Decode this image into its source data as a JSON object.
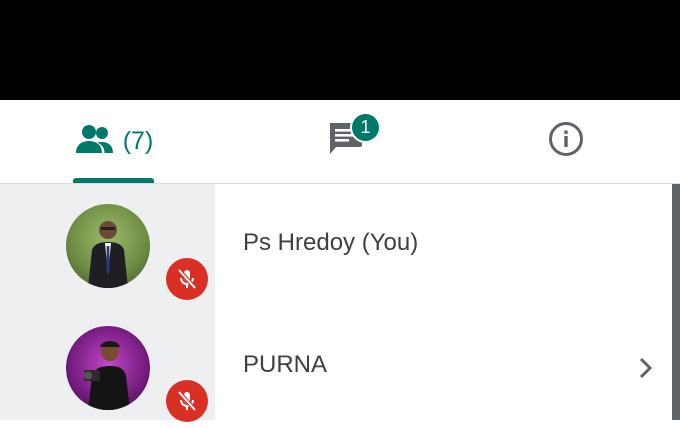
{
  "tabs": {
    "people": {
      "icon": "people-icon",
      "count": "(7)",
      "selected": true
    },
    "chat": {
      "icon": "chat-icon",
      "badge": "1"
    },
    "info": {
      "icon": "info-icon"
    }
  },
  "participants": [
    {
      "name": "Ps Hredoy (You)",
      "avatar": "avatar-photo",
      "muted": true,
      "mic_icon": "mic-off-icon"
    },
    {
      "name": "PURNA",
      "avatar": "avatar-photo",
      "muted": true,
      "mic_icon": "mic-off-icon",
      "action_icon": "chevron-right-icon"
    }
  ],
  "colors": {
    "accent": "#00796b",
    "muted_badge": "#d93025",
    "text": "#3c4043",
    "icon": "#5f6368"
  }
}
